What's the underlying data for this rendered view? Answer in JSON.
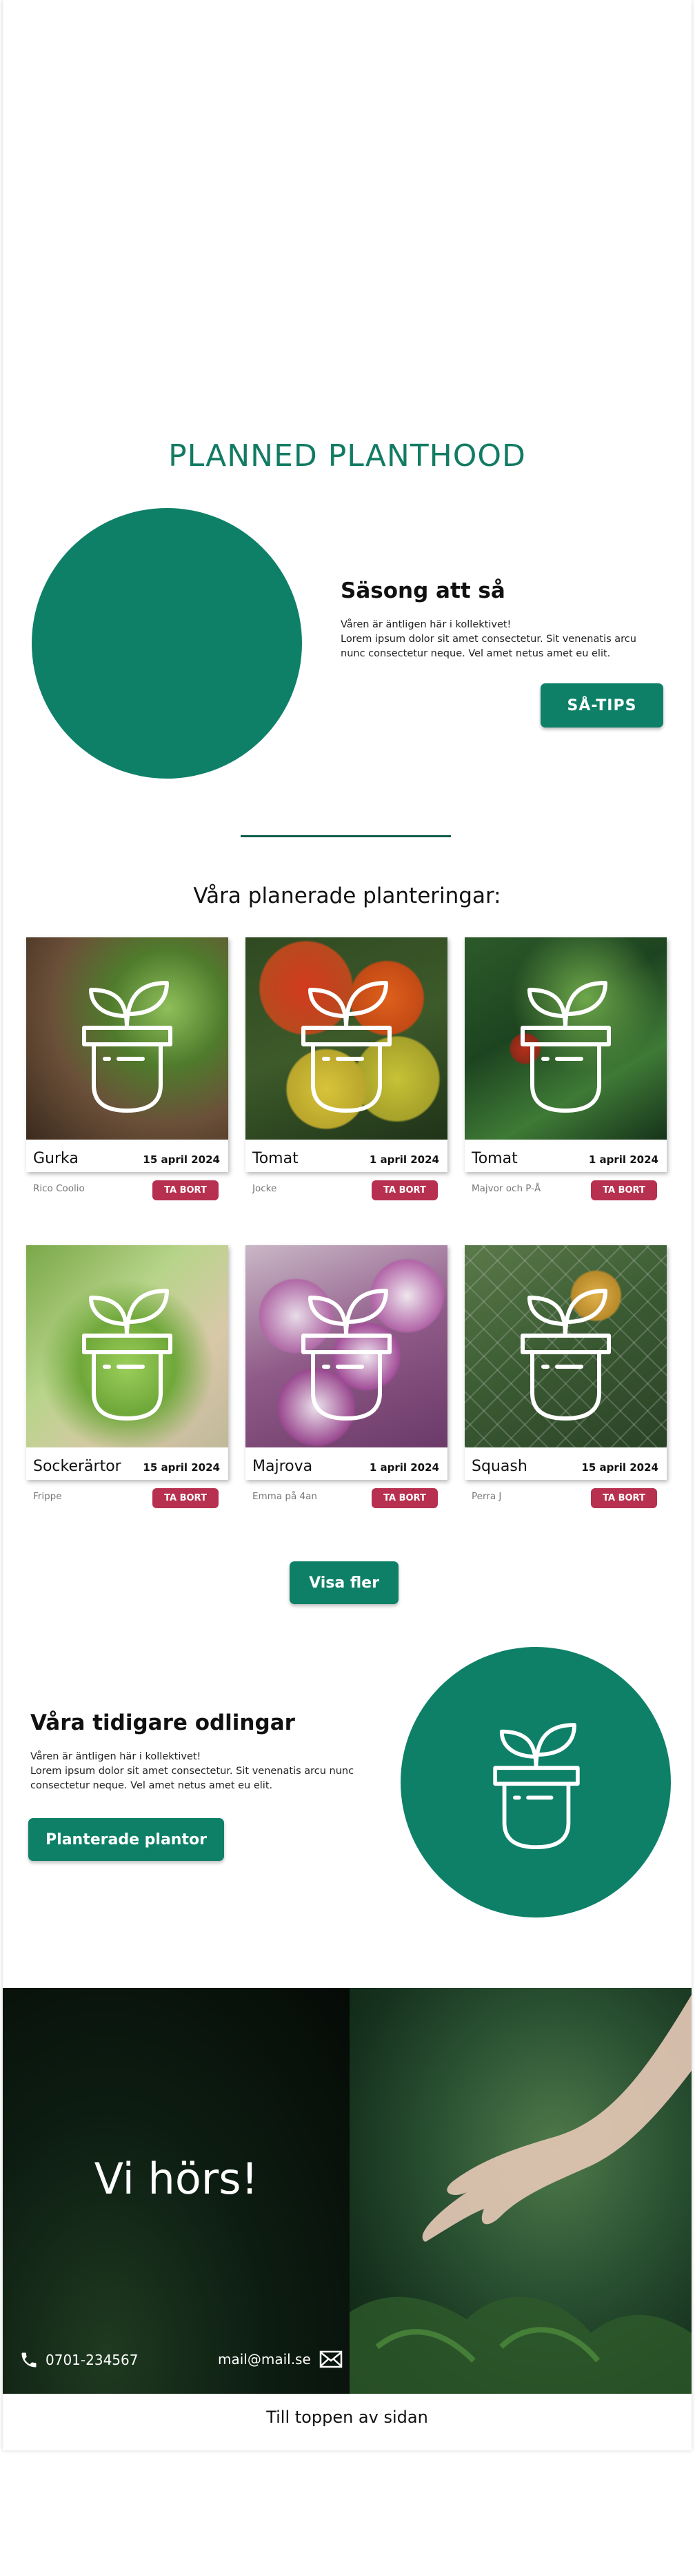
{
  "brand": {
    "title": "PLANNED PLANTHOOD"
  },
  "season": {
    "title": "Säsong att så",
    "text_line1": "Våren är äntligen här i kollektivet!",
    "text_line2": "Lorem ipsum dolor sit amet consectetur. Sit venenatis arcu nunc consectetur neque. Vel amet netus amet eu elit.",
    "button": "SÅ-TIPS"
  },
  "planned": {
    "title": "Våra planerade planteringar:",
    "cards": [
      {
        "name": "Gurka",
        "date": "15 april 2024",
        "author": "Rico Coolio",
        "delete": "TA BORT",
        "photo": "cucumber-photo"
      },
      {
        "name": "Tomat",
        "date": "1 april 2024",
        "author": "Jocke",
        "delete": "TA BORT",
        "photo": "tomato-photo"
      },
      {
        "name": "Tomat",
        "date": "1 april 2024",
        "author": "Majvor och P-Å",
        "delete": "TA BORT",
        "photo": "tomato-plant-photo"
      },
      {
        "name": "Sockerärtor",
        "date": "15 april 2024",
        "author": "Frippe",
        "delete": "TA BORT",
        "photo": "snap-pea-photo"
      },
      {
        "name": "Majrova",
        "date": "1 april 2024",
        "author": "Emma på 4an",
        "delete": "TA BORT",
        "photo": "turnip-photo"
      },
      {
        "name": "Squash",
        "date": "15 april 2024",
        "author": "Perra J",
        "delete": "TA BORT",
        "photo": "squash-photo"
      }
    ],
    "show_more": "Visa fler"
  },
  "previous": {
    "title": "Våra tidigare odlingar",
    "text_line1": "Våren är äntligen här i kollektivet!",
    "text_line2": "Lorem ipsum dolor sit amet consectetur. Sit venenatis arcu nunc consectetur neque. Vel amet netus amet eu elit.",
    "button": "Planterade plantor"
  },
  "footer": {
    "heading": "Vi hörs!",
    "phone": "0701-234567",
    "email": "mail@mail.se",
    "phone_icon": "phone-icon",
    "email_icon": "envelope-icon"
  },
  "to_top": "Till toppen av sidan",
  "colors": {
    "brand_green": "#0e8068",
    "delete_red": "#b8304f"
  }
}
